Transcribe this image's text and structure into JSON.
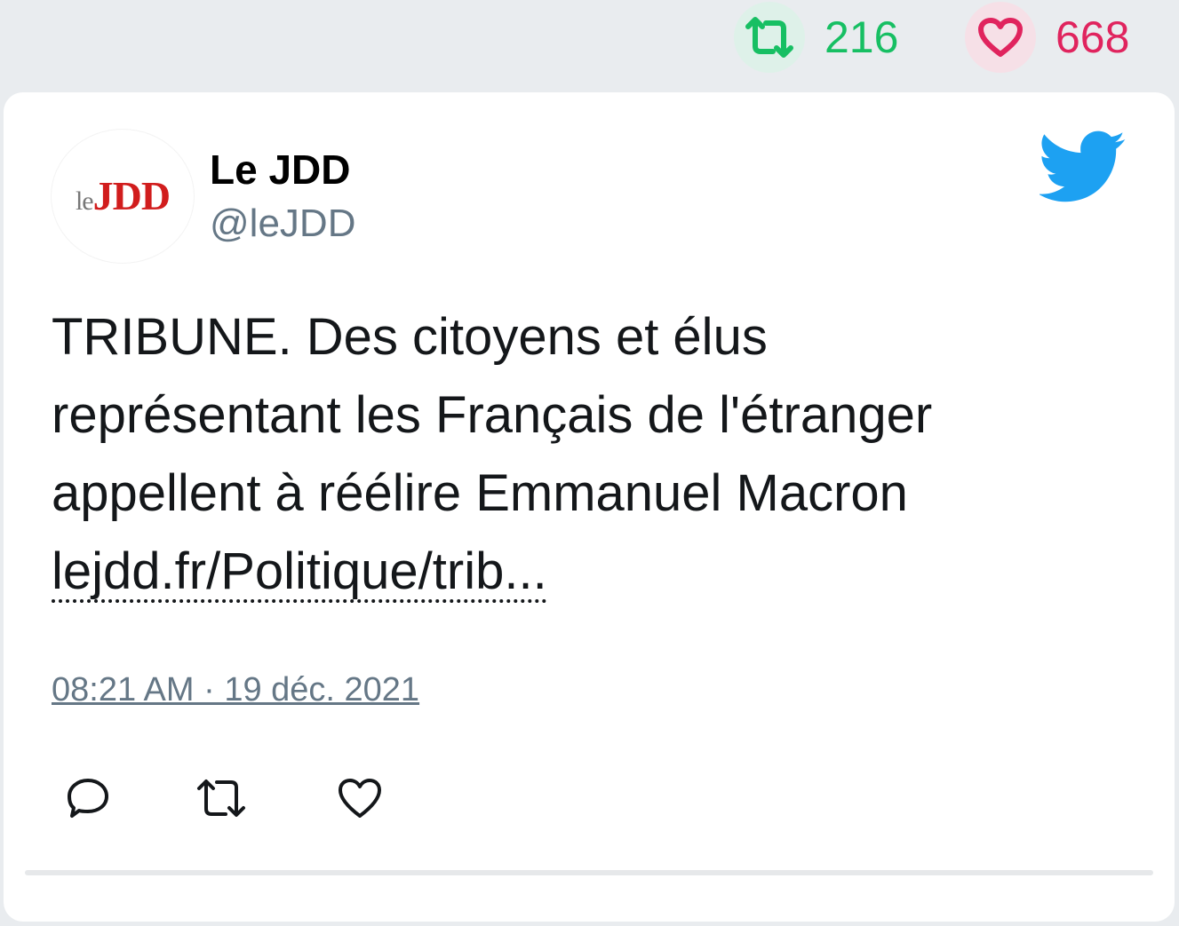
{
  "stats": {
    "retweet_icon": "retweet-icon",
    "retweet_count": "216",
    "like_icon": "heart-icon",
    "like_count": "668",
    "retweet_color": "#17bf63",
    "like_color": "#e0245e"
  },
  "tweet": {
    "author": {
      "avatar_logo_le": "le",
      "avatar_logo_jdd": "JDD",
      "name": "Le JDD",
      "handle": "@leJDD"
    },
    "platform_icon": "twitter-bird-icon",
    "text_lines": [
      "TRIBUNE. Des citoyens et élus",
      "représentant les Français de l'étranger",
      "appellent à réélire Emmanuel Macron"
    ],
    "link_text": "lejdd.fr/Politique/trib...",
    "timestamp": "08:21 AM · 19 déc. 2021",
    "actions": [
      {
        "icon": "reply-icon"
      },
      {
        "icon": "retweet-icon"
      },
      {
        "icon": "like-icon"
      }
    ]
  }
}
